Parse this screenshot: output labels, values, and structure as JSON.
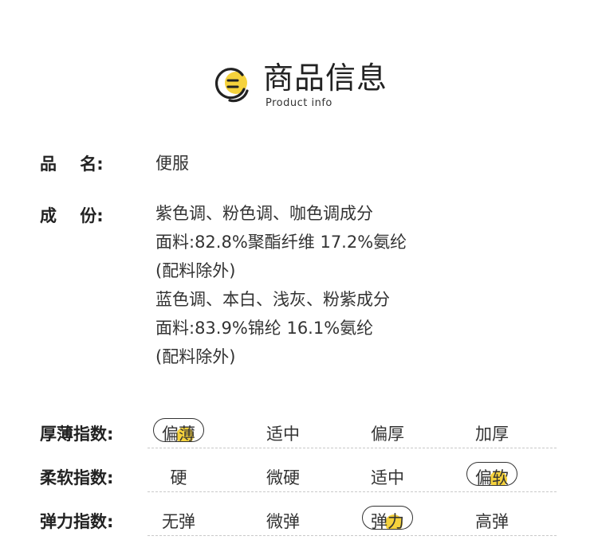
{
  "header": {
    "title_cn": "商品信息",
    "title_en": "Product info",
    "accent_color": "#f5d23c"
  },
  "product": {
    "name_label": "品    名:",
    "name_value": "便服",
    "composition_label": "成    份:",
    "composition_lines": [
      "紫色调、粉色调、咖色调成分",
      "面料:82.8%聚酯纤维 17.2%氨纶",
      "(配料除外)",
      "蓝色调、本白、浅灰、粉紫成分",
      "面料:83.9%锦纶 16.1%氨纶",
      "(配料除外)"
    ]
  },
  "indices": [
    {
      "label": "厚薄指数:",
      "options": [
        "偏薄",
        "适中",
        "偏厚",
        "加厚"
      ],
      "selected": "偏薄"
    },
    {
      "label": "柔软指数:",
      "options": [
        "硬",
        "微硬",
        "适中",
        "偏软"
      ],
      "selected": "偏软"
    },
    {
      "label": "弹力指数:",
      "options": [
        "无弹",
        "微弹",
        "弹力",
        "高弹"
      ],
      "selected": "弹力"
    }
  ]
}
